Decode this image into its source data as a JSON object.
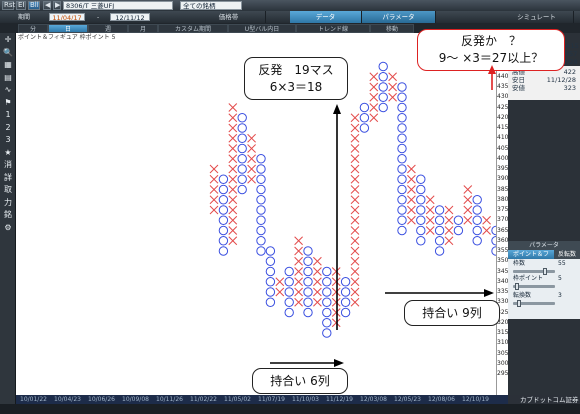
{
  "toolbar": {
    "btn1": "Rst",
    "btn2": "EI",
    "btn3": "Bll",
    "symbol": "8306/T 三菱UFJ",
    "filter": "全ての銘柄",
    "period_label": "期間",
    "date_from": "11/04/17",
    "date_to": "12/11/12",
    "dash": "-"
  },
  "tabs": [
    "価格帯",
    "データ",
    "パラメータ",
    "シミュレート"
  ],
  "subtabs": [
    "分",
    "日",
    "週",
    "月",
    "カスタム期間",
    "U型バル内日",
    "トレンド線",
    "移動"
  ],
  "left_icons": [
    {
      "name": "crosshair-icon",
      "glyph": "✛"
    },
    {
      "name": "zoom-icon",
      "glyph": "🔍"
    },
    {
      "name": "bank-icon",
      "glyph": "▦"
    },
    {
      "name": "chart-icon",
      "glyph": "▤"
    },
    {
      "name": "wave-icon",
      "glyph": "∿"
    },
    {
      "name": "flag-icon",
      "glyph": "⚑"
    },
    {
      "name": "one-icon",
      "glyph": "1"
    },
    {
      "name": "two-icon",
      "glyph": "2"
    },
    {
      "name": "three-icon",
      "glyph": "3"
    },
    {
      "name": "star-icon",
      "glyph": "★"
    },
    {
      "name": "erase-icon",
      "glyph": "消"
    },
    {
      "name": "detail-icon",
      "glyph": "詳"
    },
    {
      "name": "fetch-icon",
      "glyph": "取"
    },
    {
      "name": "input-icon",
      "glyph": "力"
    },
    {
      "name": "brand-icon",
      "glyph": "銘"
    },
    {
      "name": "gear-icon",
      "glyph": "⚙"
    }
  ],
  "chart": {
    "title": "ポイント＆フィギュア 枠ポイント 5",
    "yticks": [
      "455",
      "450",
      "445",
      "440",
      "435",
      "430",
      "425",
      "420",
      "415",
      "410",
      "405",
      "400",
      "395",
      "390",
      "385",
      "380",
      "375",
      "370",
      "365",
      "360",
      "355",
      "350",
      "345",
      "340",
      "335",
      "330",
      "325",
      "320",
      "315",
      "310",
      "305",
      "300",
      "295"
    ],
    "xticks": [
      "10/01/22",
      "10/04/23",
      "10/06/26",
      "10/09/08",
      "10/11/26",
      "11/02/22",
      "11/05/02",
      "11/07/19",
      "11/10/03",
      "11/12/19",
      "12/03/08",
      "12/05/23",
      "12/08/06",
      "12/10/19"
    ]
  },
  "info": {
    "rows": [
      {
        "label": "高値",
        "value": "422"
      },
      {
        "label": "安日",
        "value": "11/12/28"
      },
      {
        "label": "安値",
        "value": "323"
      }
    ],
    "partial": [
      "#15",
      "457",
      "2/28"
    ]
  },
  "params": {
    "head": "パラメータ",
    "tab1": "ポイント＆フ",
    "tab2": "反転数",
    "rows": [
      {
        "label": "枠数",
        "value": "55"
      },
      {
        "label": "枠ポイント",
        "value": "5"
      },
      {
        "label": "転換数",
        "value": "3"
      }
    ]
  },
  "callouts": {
    "reversal19": [
      "反発　19マス",
      "6×3＝18"
    ],
    "reversal27": [
      "反発か　？",
      "9～ ×3＝27以上？"
    ],
    "cons6": "持合い 6列",
    "cons9": "持合い 9列"
  },
  "branding": {
    "logo": "カブドットコム証券"
  },
  "colors": {
    "x_mark": "#e34b4b",
    "o_mark": "#3a4fe0",
    "accent_tab": "#2f78a8"
  },
  "chart_data": {
    "type": "point-and-figure",
    "box_size": 5,
    "reversal": 3,
    "columns": [
      {
        "type": "X",
        "low": 375,
        "high": 395
      },
      {
        "type": "O",
        "low": 355,
        "high": 390
      },
      {
        "type": "X",
        "low": 360,
        "high": 425
      },
      {
        "type": "O",
        "low": 385,
        "high": 420
      },
      {
        "type": "X",
        "low": 390,
        "high": 410
      },
      {
        "type": "O",
        "low": 355,
        "high": 400
      },
      {
        "type": "O",
        "low": 330,
        "high": 355
      },
      {
        "type": "X",
        "low": 335,
        "high": 340
      },
      {
        "type": "O",
        "low": 325,
        "high": 345
      },
      {
        "type": "X",
        "low": 330,
        "high": 360
      },
      {
        "type": "O",
        "low": 325,
        "high": 355
      },
      {
        "type": "X",
        "low": 330,
        "high": 350
      },
      {
        "type": "O",
        "low": 315,
        "high": 345
      },
      {
        "type": "X",
        "low": 320,
        "high": 345
      },
      {
        "type": "O",
        "low": 325,
        "high": 340
      },
      {
        "type": "X",
        "low": 330,
        "high": 420
      },
      {
        "type": "O",
        "low": 415,
        "high": 425
      },
      {
        "type": "X",
        "low": 420,
        "high": 440
      },
      {
        "type": "O",
        "low": 425,
        "high": 445
      },
      {
        "type": "X",
        "low": 430,
        "high": 440
      },
      {
        "type": "O",
        "low": 365,
        "high": 435
      },
      {
        "type": "X",
        "low": 370,
        "high": 395
      },
      {
        "type": "O",
        "low": 360,
        "high": 390
      },
      {
        "type": "X",
        "low": 365,
        "high": 380
      },
      {
        "type": "O",
        "low": 355,
        "high": 375
      },
      {
        "type": "X",
        "low": 360,
        "high": 375
      },
      {
        "type": "O",
        "low": 365,
        "high": 370
      },
      {
        "type": "X",
        "low": 370,
        "high": 385
      },
      {
        "type": "O",
        "low": 360,
        "high": 380
      },
      {
        "type": "X",
        "low": 365,
        "high": 370
      },
      {
        "type": "O",
        "low": 355,
        "high": 365
      },
      {
        "type": "X",
        "low": 360,
        "high": 370
      }
    ]
  }
}
